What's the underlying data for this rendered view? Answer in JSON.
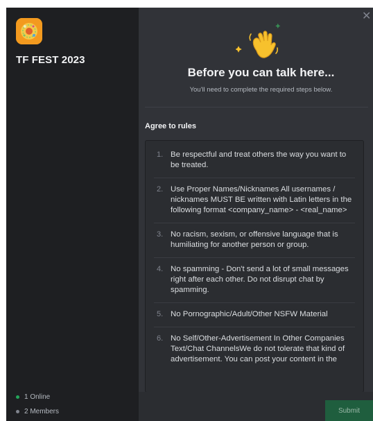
{
  "server": {
    "name": "TF FEST 2023",
    "icon": "server-logo-icon",
    "online": "1 Online",
    "members": "2 Members"
  },
  "modal": {
    "close_icon": "close-icon",
    "hero_icon": "waving-hand-icon",
    "title": "Before you can talk here...",
    "subtitle": "You'll need to complete the required steps below.",
    "section_title": "Agree to rules",
    "rules": [
      {
        "num": "1.",
        "text": "Be respectful and treat others the way you want to be treated."
      },
      {
        "num": "2.",
        "text": "Use Proper Names/Nicknames All usernames / nicknames MUST BE written with Latin letters in the following format <company_name> - <real_name>"
      },
      {
        "num": "3.",
        "text": "No racism, sexism, or offensive language that is humiliating for another person or group."
      },
      {
        "num": "4.",
        "text": "No spamming - Don't send a lot of small messages right after each other. Do not disrupt chat by spamming."
      },
      {
        "num": "5.",
        "text": "No Pornographic/Adult/Other NSFW Material"
      },
      {
        "num": "6.",
        "text": "No Self/Other-Advertisement In Other Companies Text/Chat ChannelsWe do not tolerate that kind of advertisement. You can post your content in the"
      }
    ],
    "submit_label": "Submit"
  },
  "colors": {
    "online": "#23a55a",
    "members": "#80848e",
    "submit_bg": "#1f5e3e",
    "hand": "#f7c12d",
    "sparkle": "#f7c12d",
    "sparkle_alt": "#3ba55c"
  }
}
